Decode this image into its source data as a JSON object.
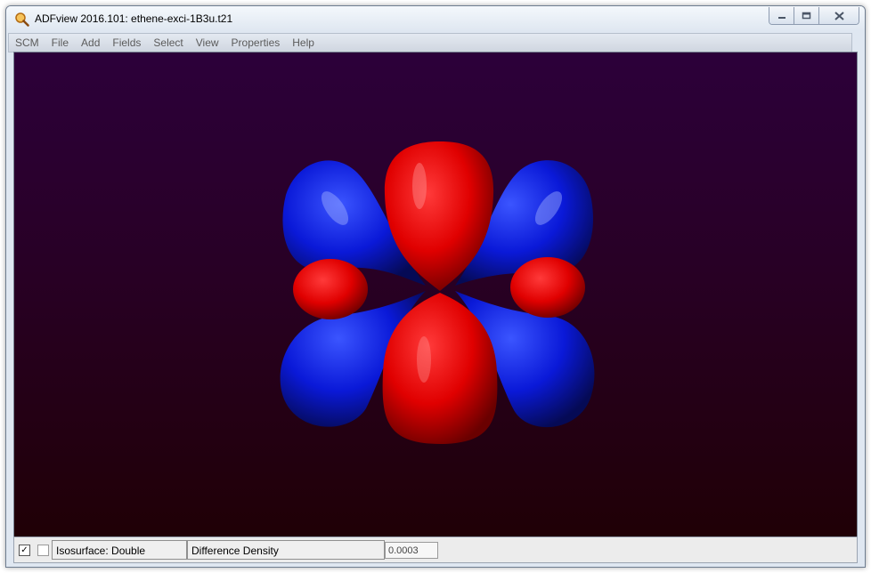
{
  "window": {
    "title": "ADFview 2016.101: ethene-exci-1B3u.t21",
    "icons": {
      "app": "magnifier-app-icon",
      "minimize": "minimize-icon",
      "maximize": "maximize-icon",
      "close": "close-icon"
    }
  },
  "menu": {
    "items": [
      "SCM",
      "File",
      "Add",
      "Fields",
      "Select",
      "View",
      "Properties",
      "Help"
    ]
  },
  "viewport": {
    "colors": {
      "positive_lobe": "#e00000",
      "negative_lobe": "#0a19d8",
      "background_top": "#2c003a",
      "background_bottom": "#200006"
    }
  },
  "statusbar": {
    "visible_checked": true,
    "second_checked": false,
    "isosurface_label": "Isosurface: Double",
    "field_label": "Difference Density",
    "value": "0.0003"
  }
}
